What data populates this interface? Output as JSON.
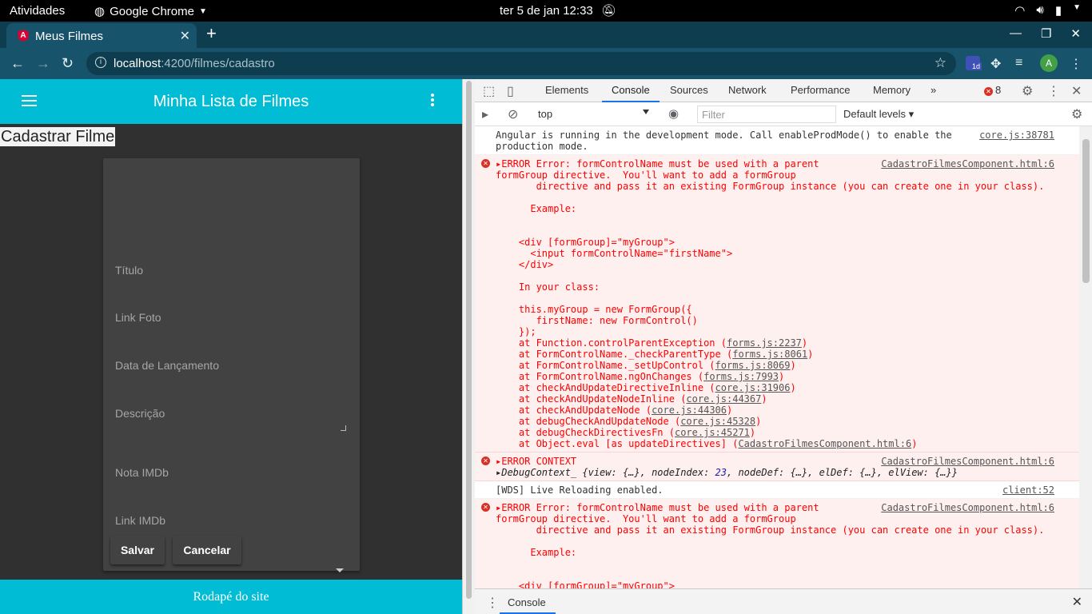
{
  "os": {
    "activities": "Atividades",
    "app_menu": "Google Chrome",
    "clock": "ter 5 de jan  12:33"
  },
  "browser": {
    "tab_title": "Meus Filmes",
    "url_host": "localhost",
    "url_path": ":4200/filmes/cadastro",
    "calendar_badge": "1d",
    "profile_initial": "A"
  },
  "app": {
    "title": "Minha Lista de Filmes",
    "page_title": "Cadastrar Filme",
    "fields": [
      {
        "label": "Título"
      },
      {
        "label": "Link Foto"
      },
      {
        "label": "Data de Lançamento"
      },
      {
        "label": "Descrição"
      },
      {
        "label": "Nota IMDb"
      },
      {
        "label": "Link IMDb"
      }
    ],
    "save_label": "Salvar",
    "cancel_label": "Cancelar",
    "footer": "Rodapé do site",
    "accent": "#00bcd4"
  },
  "devtools": {
    "tabs": [
      "Elements",
      "Console",
      "Sources",
      "Network",
      "Performance",
      "Memory"
    ],
    "error_count": "8",
    "context": "top",
    "filter_placeholder": "Filter",
    "levels": "Default levels",
    "drawer_tab": "Console",
    "messages": {
      "m1_text": "Angular is running in the development mode. Call enableProdMode() to enable the\nproduction mode.",
      "m1_src": "core.js:38781",
      "m2_text": "▸ERROR Error: formControlName must be used with a parent\nformGroup directive.  You'll want to add a formGroup\n       directive and pass it an existing FormGroup instance (you can create one in your class).\n\n      Example:\n\n\n    <div [formGroup]=\"myGroup\">\n      <input formControlName=\"firstName\">\n    </div>\n\n    In your class:\n\n    this.myGroup = new FormGroup({\n       firstName: new FormControl()\n    });",
      "m2_src": "CadastroFilmesComponent.html:6",
      "stack": [
        {
          "fn": "    at Function.controlParentException (",
          "file": "forms.js:2237"
        },
        {
          "fn": "    at FormControlName._checkParentType (",
          "file": "forms.js:8061"
        },
        {
          "fn": "    at FormControlName._setUpControl (",
          "file": "forms.js:8069"
        },
        {
          "fn": "    at FormControlName.ngOnChanges (",
          "file": "forms.js:7993"
        },
        {
          "fn": "    at checkAndUpdateDirectiveInline (",
          "file": "core.js:31906"
        },
        {
          "fn": "    at checkAndUpdateNodeInline (",
          "file": "core.js:44367"
        },
        {
          "fn": "    at checkAndUpdateNode (",
          "file": "core.js:44306"
        },
        {
          "fn": "    at debugCheckAndUpdateNode (",
          "file": "core.js:45328"
        },
        {
          "fn": "    at debugCheckDirectivesFn (",
          "file": "core.js:45271"
        },
        {
          "fn": "    at Object.eval [as updateDirectives] (",
          "file": "CadastroFilmesComponent.html:6"
        }
      ],
      "m3_text": "▸ERROR CONTEXT",
      "m3_src": "CadastroFilmesComponent.html:6",
      "m3_ctx_a": "▸DebugContext_ {view: {…}, nodeIndex: ",
      "m3_ctx_num": "23",
      "m3_ctx_b": ", nodeDef: {…}, elDef: {…}, elView: {…}}",
      "m4_text": "[WDS] Live Reloading enabled.",
      "m4_src": "client:52",
      "m5_text": "▸ERROR Error: formControlName must be used with a parent\nformGroup directive.  You'll want to add a formGroup\n       directive and pass it an existing FormGroup instance (you can create one in your class).\n\n      Example:\n\n\n    <div [formGroup]=\"myGroup\">",
      "m5_src": "CadastroFilmesComponent.html:6"
    }
  }
}
